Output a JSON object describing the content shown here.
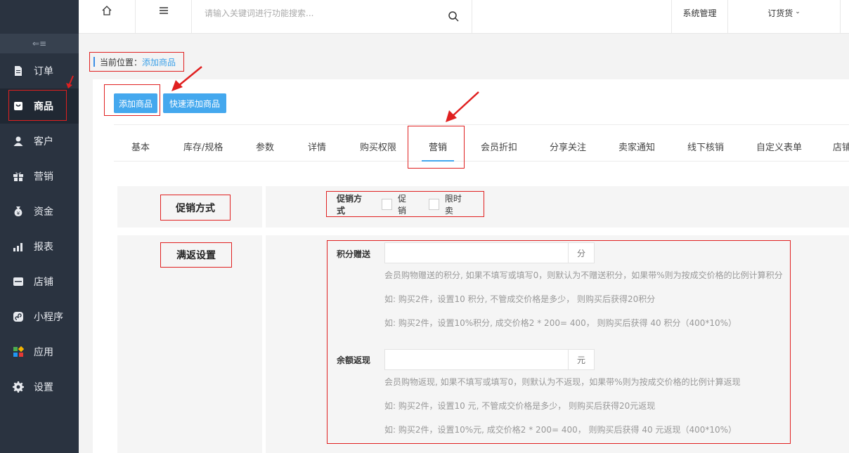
{
  "sidebar": {
    "collapse_icon": "collapse-icon",
    "items": [
      {
        "label": "订单",
        "icon": "file-icon"
      },
      {
        "label": "商品",
        "icon": "product-icon",
        "active": true
      },
      {
        "label": "客户",
        "icon": "user-icon"
      },
      {
        "label": "营销",
        "icon": "gift-icon"
      },
      {
        "label": "资金",
        "icon": "money-bag-icon"
      },
      {
        "label": "报表",
        "icon": "bar-chart-icon"
      },
      {
        "label": "店铺",
        "icon": "store-icon"
      },
      {
        "label": "小程序",
        "icon": "miniprogram-icon"
      },
      {
        "label": "应用",
        "icon": "apps-icon"
      },
      {
        "label": "设置",
        "icon": "gear-icon"
      }
    ]
  },
  "topbar": {
    "search_placeholder": "请输入关键词进行功能搜索...",
    "system_manage": "系统管理",
    "order_goods": "订货货"
  },
  "breadcrumb": {
    "prefix": "当前位置：",
    "current": "添加商品"
  },
  "buttons": {
    "add_product": "添加商品",
    "quick_add_product": "快速添加商品"
  },
  "tabs": [
    "基本",
    "库存/规格",
    "参数",
    "详情",
    "购买权限",
    "营销",
    "会员折扣",
    "分享关注",
    "卖家通知",
    "线下核销",
    "自定义表单",
    "店铺"
  ],
  "active_tab": "营销",
  "promo_section": {
    "title": "促销方式",
    "field_label": "促销方式",
    "options": [
      "促销",
      "限时卖"
    ]
  },
  "rebate_section": {
    "title": "满返设置",
    "points": {
      "label": "积分赠送",
      "unit": "分",
      "hints": [
        "会员购物赠送的积分, 如果不填写或填写0，则默认为不赠送积分，如果带%则为按成交价格的比例计算积分",
        "如: 购买2件，设置10 积分, 不管成交价格是多少， 则购买后获得20积分",
        "如: 购买2件，设置10%积分, 成交价格2 * 200= 400， 则购买后获得 40 积分（400*10%）"
      ]
    },
    "balance": {
      "label": "余额返现",
      "unit": "元",
      "hints": [
        "会员购物返现, 如果不填写或填写0，则默认为不返现，如果带%则为按成交价格的比例计算返现",
        "如: 购买2件，设置10 元, 不管成交价格是多少， 则购买后获得20元返现",
        "如: 购买2件，设置10%元, 成交价格2 * 200= 400， 则购买后获得 40 元返现（400*10%）"
      ]
    }
  }
}
